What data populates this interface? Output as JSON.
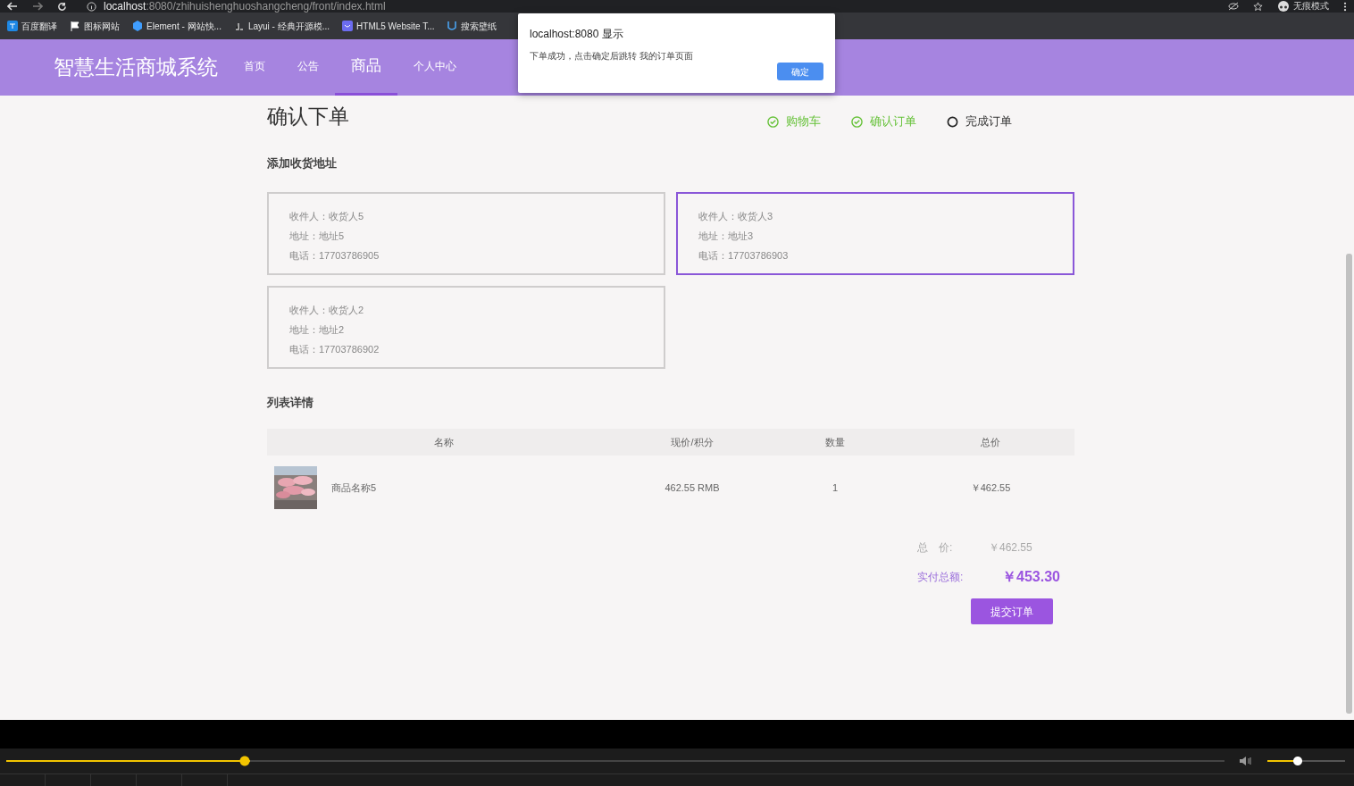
{
  "browser": {
    "url_host": "localhost",
    "url_rest": ":8080/zhihuishenghuoshangcheng/front/index.html",
    "profile": "无痕模式",
    "bookmarks": [
      {
        "label": "百度翻译",
        "kind": "translate"
      },
      {
        "label": "图标网站",
        "kind": "flag"
      },
      {
        "label": "Element - 网站快...",
        "kind": "hex"
      },
      {
        "label": "Layui - 经典开源模...",
        "kind": "layui"
      },
      {
        "label": "HTML5 Website T...",
        "kind": "html5"
      },
      {
        "label": "搜索壁纸",
        "kind": "wallpaper"
      }
    ]
  },
  "navbar": {
    "brand": "智慧生活商城系统",
    "items": [
      {
        "label": "首页",
        "selected": false
      },
      {
        "label": "公告",
        "selected": false
      },
      {
        "label": "商品",
        "selected": true
      },
      {
        "label": "个人中心",
        "selected": false
      }
    ]
  },
  "page": {
    "title": "确认下单",
    "steps": [
      {
        "label": "购物车",
        "done": true
      },
      {
        "label": "确认订单",
        "done": true
      },
      {
        "label": "完成订单",
        "done": false
      }
    ],
    "address_heading": "添加收货地址",
    "addresses": [
      {
        "receiver": "收件人：收货人5",
        "address": "地址：地址5",
        "phone": "电话：17703786905",
        "selected": false
      },
      {
        "receiver": "收件人：收货人3",
        "address": "地址：地址3",
        "phone": "电话：17703786903",
        "selected": true
      },
      {
        "receiver": "收件人：收货人2",
        "address": "地址：地址2",
        "phone": "电话：17703786902",
        "selected": false
      }
    ],
    "list_heading": "列表详情",
    "table": {
      "columns": [
        "名称",
        "现价/积分",
        "数量",
        "总价"
      ],
      "rows": [
        {
          "name": "商品名称5",
          "price": "462.55 RMB",
          "quantity": "1",
          "total": "￥462.55"
        }
      ]
    },
    "total_label": "总　价:",
    "total_value": "￥462.55",
    "paid_label": "实付总额:",
    "paid_value": "￥453.30",
    "submit": "提交订单"
  },
  "dialog": {
    "title": "localhost:8080 显示",
    "message": "下单成功，点击确定后跳转 我的订单页面",
    "button": "确定"
  },
  "player": {
    "progress": {
      "level": 0.2
    },
    "volume": {
      "level": 0.45
    }
  }
}
